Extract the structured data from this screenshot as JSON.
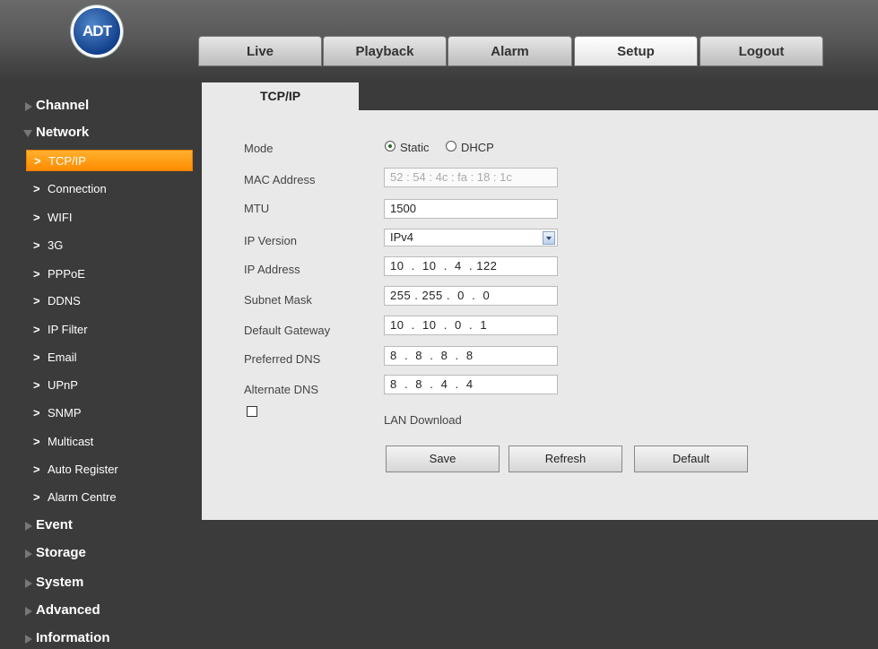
{
  "logo": {
    "text": "ADT"
  },
  "top_tabs": [
    {
      "label": "Live"
    },
    {
      "label": "Playback"
    },
    {
      "label": "Alarm"
    },
    {
      "label": "Setup"
    },
    {
      "label": "Logout"
    }
  ],
  "sidebar": {
    "channel": "Channel",
    "network": "Network",
    "network_items": [
      "TCP/IP",
      "Connection",
      "WIFI",
      "3G",
      "PPPoE",
      "DDNS",
      "IP Filter",
      "Email",
      "UPnP",
      "SNMP",
      "Multicast",
      "Auto Register",
      "Alarm Centre"
    ],
    "event": "Event",
    "storage": "Storage",
    "system": "System",
    "advanced": "Advanced",
    "information": "Information"
  },
  "content": {
    "tab_label": "TCP/IP",
    "mode_label": "Mode",
    "mode_static": "Static",
    "mode_dhcp": "DHCP",
    "mac_label": "MAC Address",
    "mac_value": "52 : 54 : 4c : fa : 18 : 1c",
    "mtu_label": "MTU",
    "mtu_value": "1500",
    "ipversion_label": "IP Version",
    "ipversion_value": "IPv4",
    "ip_label": "IP Address",
    "ip_value": "10  .  10  .  4  . 122",
    "subnet_label": "Subnet Mask",
    "subnet_value": "255 . 255 .  0  .  0",
    "gateway_label": "Default Gateway",
    "gateway_value": "10  .  10  .  0  .  1",
    "pdns_label": "Preferred DNS",
    "pdns_value": "8  .  8  .  8  .  8",
    "adns_label": "Alternate DNS",
    "adns_value": "8  .  8  .  4  .  4",
    "lan_download_label": "LAN Download",
    "save": "Save",
    "refresh": "Refresh",
    "default": "Default"
  }
}
